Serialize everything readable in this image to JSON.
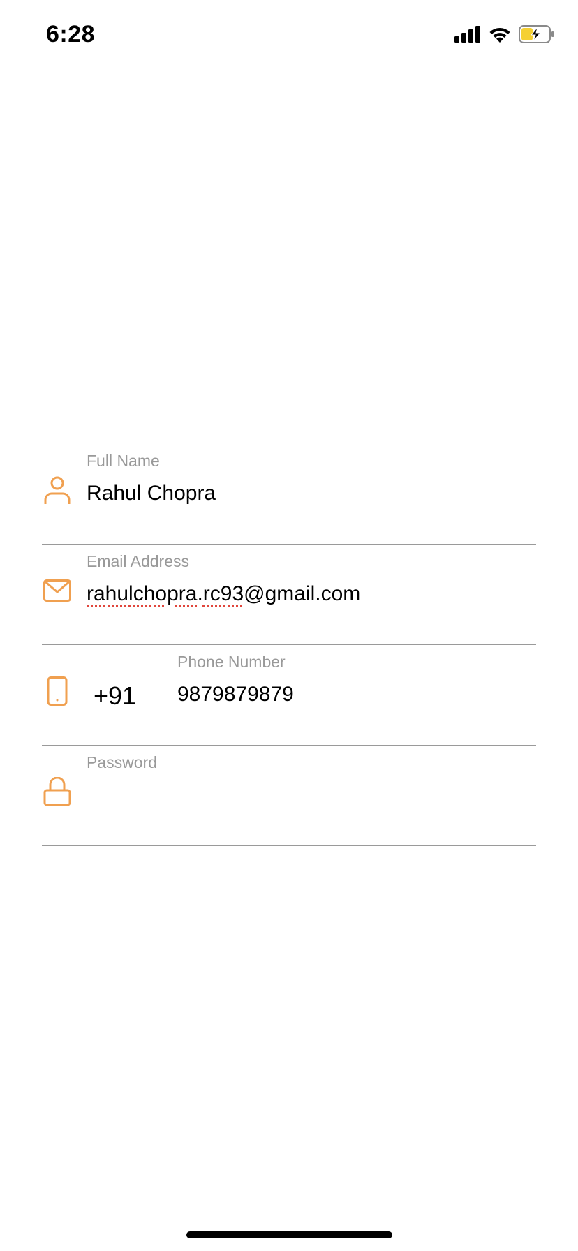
{
  "status_bar": {
    "time": "6:28",
    "icons": [
      "cellular-signal-icon",
      "wifi-icon",
      "battery-charging-icon"
    ]
  },
  "colors": {
    "accent": "#F0A050",
    "label": "#999999",
    "divider": "#9A9A9A",
    "battery_fill": "#F5D033",
    "spellcheck": "#E0463C"
  },
  "form": {
    "full_name": {
      "label": "Full Name",
      "value": "Rahul Chopra",
      "icon": "person-icon"
    },
    "email": {
      "label": "Email Address",
      "value_misspelled_part": "rahulchopra",
      "value_dot": ".",
      "value_misspelled_part2": "rc93",
      "value_rest": "@gmail.com",
      "icon": "mail-icon"
    },
    "phone": {
      "label": "Phone Number",
      "country_code": "+91",
      "value": "9879879879",
      "icon": "phone-icon"
    },
    "password": {
      "label": "Password",
      "value": "",
      "icon": "lock-icon"
    }
  }
}
